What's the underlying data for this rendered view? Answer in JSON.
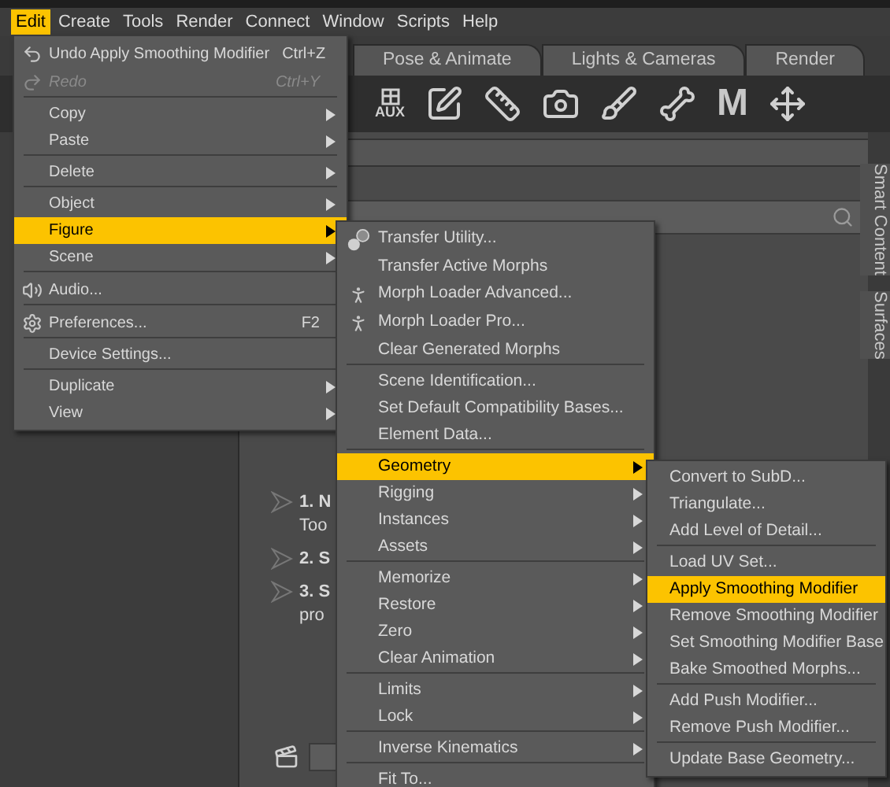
{
  "menubar": [
    {
      "label": "Edit",
      "selected": true
    },
    {
      "label": "Create",
      "selected": false
    },
    {
      "label": "Tools",
      "selected": false
    },
    {
      "label": "Render",
      "selected": false
    },
    {
      "label": "Connect",
      "selected": false
    },
    {
      "label": "Window",
      "selected": false
    },
    {
      "label": "Scripts",
      "selected": false
    },
    {
      "label": "Help",
      "selected": false
    }
  ],
  "tabs": [
    {
      "label": "Pose & Animate",
      "selected": false
    },
    {
      "label": "Lights & Cameras",
      "selected": false
    },
    {
      "label": "Render",
      "selected": false
    }
  ],
  "toolbar": [
    {
      "kind": "aux",
      "label": "AUX"
    },
    {
      "kind": "edit"
    },
    {
      "kind": "measure"
    },
    {
      "kind": "camera"
    },
    {
      "kind": "brush"
    },
    {
      "kind": "bone"
    },
    {
      "kind": "letter",
      "label": "M"
    },
    {
      "kind": "move"
    }
  ],
  "side_tabs": [
    {
      "label": "Smart Content",
      "selected": false
    },
    {
      "label": "Surfaces",
      "selected": false
    }
  ],
  "steps": [
    {
      "number": "1. N",
      "text": "Too"
    },
    {
      "number": "2. S"
    },
    {
      "number": "3. S",
      "text": "pro"
    }
  ],
  "edit_menu": [
    {
      "kind": "undo",
      "label": "Undo Apply Smoothing Modifier",
      "shortcut": "Ctrl+Z",
      "submenu": false,
      "disabled": false,
      "selected": false
    },
    {
      "kind": "redo",
      "label": "Redo",
      "shortcut": "Ctrl+Y",
      "submenu": false,
      "disabled": true,
      "selected": false
    },
    {
      "kind": "separator"
    },
    {
      "kind": "item",
      "label": "Copy",
      "submenu": true,
      "disabled": false,
      "selected": false
    },
    {
      "kind": "item",
      "label": "Paste",
      "submenu": true,
      "disabled": false,
      "selected": false
    },
    {
      "kind": "separator"
    },
    {
      "kind": "item",
      "label": "Delete",
      "submenu": true,
      "disabled": false,
      "selected": false
    },
    {
      "kind": "separator"
    },
    {
      "kind": "item",
      "label": "Object",
      "submenu": true,
      "disabled": false,
      "selected": false
    },
    {
      "kind": "item",
      "label": "Figure",
      "submenu": true,
      "disabled": false,
      "selected": true
    },
    {
      "kind": "item",
      "label": "Scene",
      "submenu": true,
      "disabled": false,
      "selected": false
    },
    {
      "kind": "separator"
    },
    {
      "kind": "audio",
      "label": "Audio...",
      "submenu": false,
      "disabled": false,
      "selected": false
    },
    {
      "kind": "separator"
    },
    {
      "kind": "settings",
      "label": "Preferences...",
      "shortcut": "F2",
      "submenu": false,
      "disabled": false,
      "selected": false
    },
    {
      "kind": "separator"
    },
    {
      "kind": "item",
      "label": "Device Settings...",
      "submenu": false,
      "disabled": false,
      "selected": false
    },
    {
      "kind": "separator"
    },
    {
      "kind": "item",
      "label": "Duplicate",
      "submenu": true,
      "disabled": false,
      "selected": false
    },
    {
      "kind": "item",
      "label": "View",
      "submenu": true,
      "disabled": false,
      "selected": false
    }
  ],
  "figure_menu": [
    {
      "kind": "transfer",
      "label": "Transfer Utility...",
      "submenu": false,
      "selected": false
    },
    {
      "kind": "item",
      "label": "Transfer Active Morphs",
      "submenu": false,
      "selected": false
    },
    {
      "kind": "morph",
      "label": "Morph Loader Advanced...",
      "submenu": false,
      "selected": false
    },
    {
      "kind": "morph",
      "label": "Morph Loader Pro...",
      "submenu": false,
      "selected": false
    },
    {
      "kind": "item",
      "label": "Clear Generated Morphs",
      "submenu": false,
      "selected": false
    },
    {
      "kind": "separator"
    },
    {
      "kind": "item",
      "label": "Scene Identification...",
      "submenu": false,
      "selected": false
    },
    {
      "kind": "item",
      "label": "Set Default Compatibility Bases...",
      "submenu": false,
      "selected": false
    },
    {
      "kind": "item",
      "label": "Element Data...",
      "submenu": false,
      "selected": false
    },
    {
      "kind": "separator"
    },
    {
      "kind": "item",
      "label": "Geometry",
      "submenu": true,
      "selected": true
    },
    {
      "kind": "item",
      "label": "Rigging",
      "submenu": true,
      "selected": false
    },
    {
      "kind": "item",
      "label": "Instances",
      "submenu": true,
      "selected": false
    },
    {
      "kind": "item",
      "label": "Assets",
      "submenu": true,
      "selected": false
    },
    {
      "kind": "separator"
    },
    {
      "kind": "item",
      "label": "Memorize",
      "submenu": true,
      "selected": false
    },
    {
      "kind": "item",
      "label": "Restore",
      "submenu": true,
      "selected": false
    },
    {
      "kind": "item",
      "label": "Zero",
      "submenu": true,
      "selected": false
    },
    {
      "kind": "item",
      "label": "Clear Animation",
      "submenu": true,
      "selected": false
    },
    {
      "kind": "separator"
    },
    {
      "kind": "item",
      "label": "Limits",
      "submenu": true,
      "selected": false
    },
    {
      "kind": "item",
      "label": "Lock",
      "submenu": true,
      "selected": false
    },
    {
      "kind": "separator"
    },
    {
      "kind": "item",
      "label": "Inverse Kinematics",
      "submenu": true,
      "selected": false
    },
    {
      "kind": "separator"
    },
    {
      "kind": "item",
      "label": "Fit To...",
      "submenu": false,
      "selected": false
    }
  ],
  "geometry_menu": [
    {
      "kind": "item",
      "label": "Convert to SubD...",
      "selected": false
    },
    {
      "kind": "item",
      "label": "Triangulate...",
      "selected": false
    },
    {
      "kind": "item",
      "label": "Add Level of Detail...",
      "selected": false
    },
    {
      "kind": "separator"
    },
    {
      "kind": "item",
      "label": "Load UV Set...",
      "selected": false
    },
    {
      "kind": "item",
      "label": "Apply Smoothing Modifier",
      "selected": true
    },
    {
      "kind": "item",
      "label": "Remove Smoothing Modifier",
      "selected": false
    },
    {
      "kind": "item",
      "label": "Set Smoothing Modifier Base",
      "selected": false
    },
    {
      "kind": "item",
      "label": "Bake Smoothed Morphs...",
      "selected": false
    },
    {
      "kind": "separator"
    },
    {
      "kind": "item",
      "label": "Add Push Modifier...",
      "selected": false
    },
    {
      "kind": "item",
      "label": "Remove Push Modifier...",
      "selected": false
    },
    {
      "kind": "separator"
    },
    {
      "kind": "item",
      "label": "Update Base Geometry...",
      "selected": false
    }
  ]
}
